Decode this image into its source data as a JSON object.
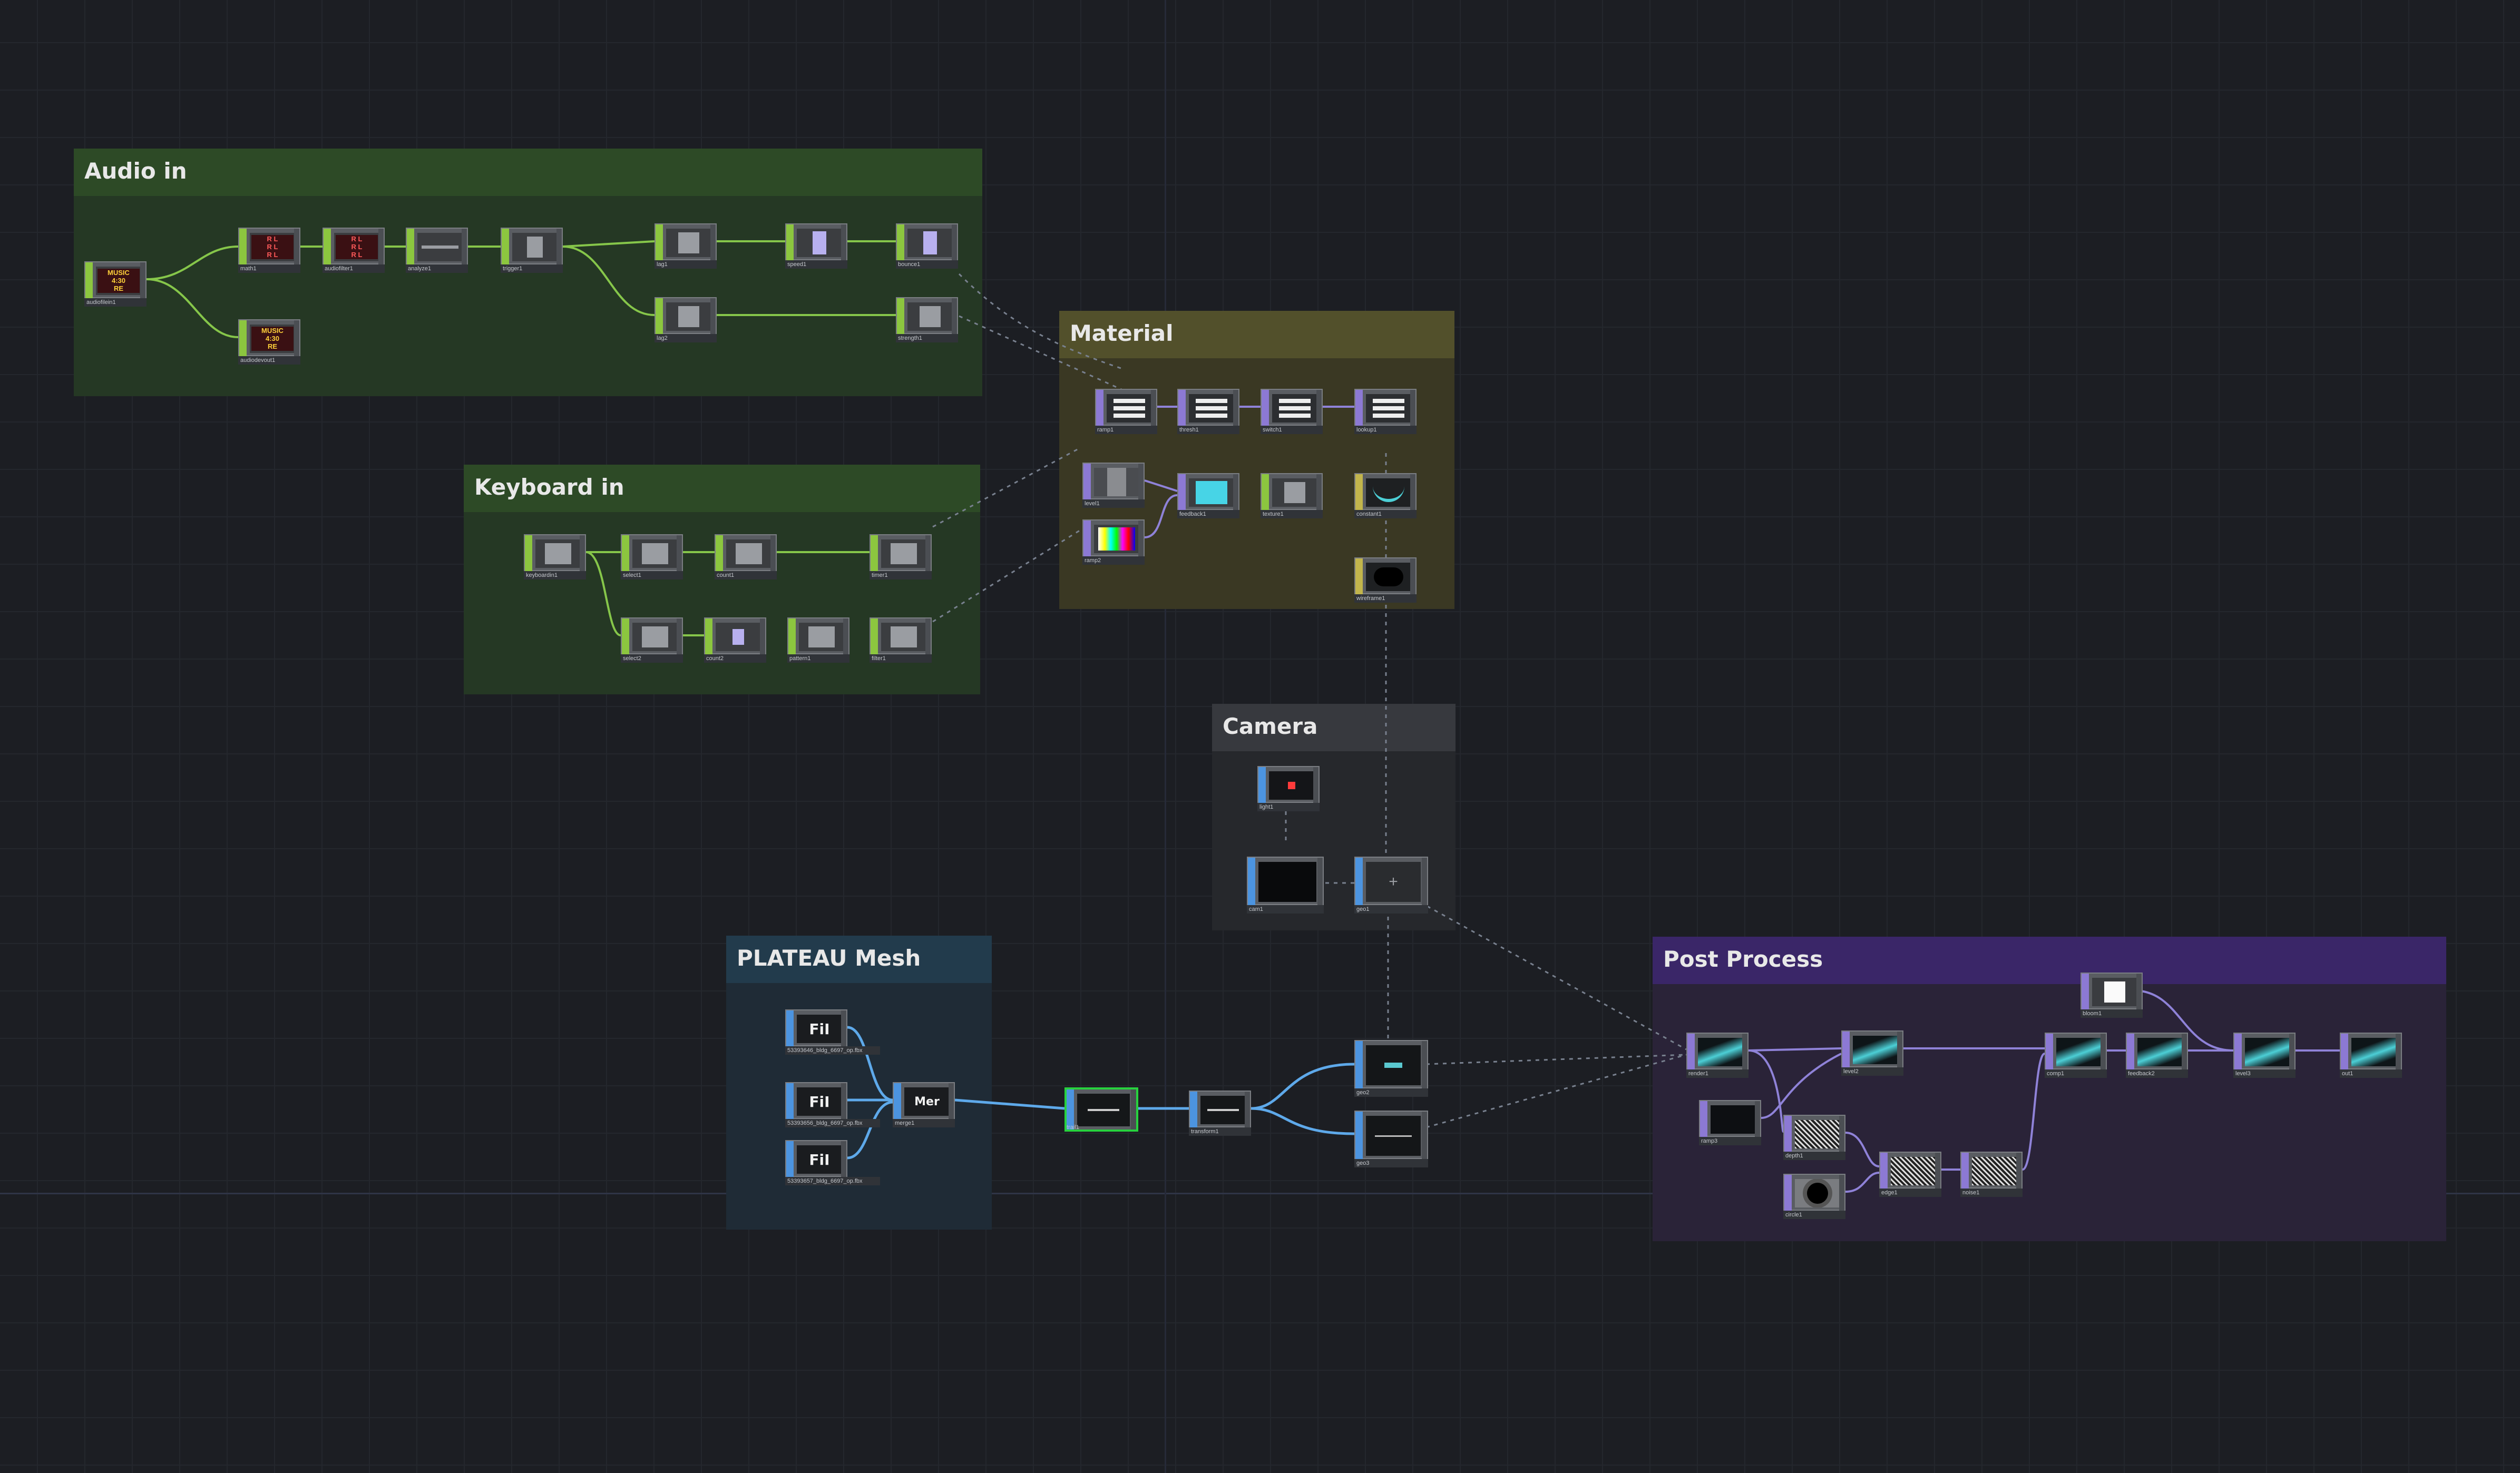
{
  "groups": {
    "audio": {
      "title": "Audio in"
    },
    "keyboard": {
      "title": "Keyboard in"
    },
    "material": {
      "title": "Material"
    },
    "camera": {
      "title": "Camera"
    },
    "plateau": {
      "title": "PLATEAU Mesh"
    },
    "post": {
      "title": "Post Process"
    }
  },
  "nodes": {
    "audiofilein": {
      "name": "audiofilein1"
    },
    "math1": {
      "name": "math1"
    },
    "audiofilter": {
      "name": "audiofilter1"
    },
    "analyze": {
      "name": "analyze1"
    },
    "trigger": {
      "name": "trigger1"
    },
    "lag1": {
      "name": "lag1"
    },
    "speed1": {
      "name": "speed1"
    },
    "bounce": {
      "name": "bounce1"
    },
    "lag2": {
      "name": "lag2"
    },
    "strength": {
      "name": "strength1"
    },
    "audiodevout": {
      "name": "audiodevout1"
    },
    "keyboardin": {
      "name": "keyboardin1"
    },
    "select1": {
      "name": "select1"
    },
    "count1": {
      "name": "count1"
    },
    "timer": {
      "name": "timer1"
    },
    "select2": {
      "name": "select2"
    },
    "count2": {
      "name": "count2"
    },
    "pattern": {
      "name": "pattern1"
    },
    "filter": {
      "name": "filter1"
    },
    "ramp1": {
      "name": "ramp1"
    },
    "thresh": {
      "name": "thresh1"
    },
    "switch1": {
      "name": "switch1"
    },
    "lookup": {
      "name": "lookup1"
    },
    "level1": {
      "name": "level1"
    },
    "ramp2": {
      "name": "ramp2"
    },
    "feedback": {
      "name": "feedback1"
    },
    "texture": {
      "name": "texture1"
    },
    "constant": {
      "name": "constant1"
    },
    "wireframe": {
      "name": "wireframe1"
    },
    "light": {
      "name": "light1"
    },
    "cam": {
      "name": "cam1"
    },
    "geo1": {
      "name": "geo1"
    },
    "file1": {
      "name": "file1",
      "glyph": "FiI",
      "path": "53393646_bldg_6697_op.fbx"
    },
    "file2": {
      "name": "file2",
      "glyph": "FiI",
      "path": "53393656_bldg_6697_op.fbx"
    },
    "file3": {
      "name": "file3",
      "glyph": "FiI",
      "path": "53393657_bldg_6697_op.fbx"
    },
    "merge": {
      "name": "merge1",
      "glyph": "Mer"
    },
    "trail": {
      "name": "trail1"
    },
    "transform": {
      "name": "transform1"
    },
    "geo2": {
      "name": "geo2"
    },
    "geo3": {
      "name": "geo3"
    },
    "render1": {
      "name": "render1"
    },
    "level2": {
      "name": "level2"
    },
    "comp1": {
      "name": "comp1"
    },
    "ramp3": {
      "name": "ramp3"
    },
    "depth": {
      "name": "depth1"
    },
    "edge": {
      "name": "edge1"
    },
    "noise": {
      "name": "noise1"
    },
    "circle": {
      "name": "circle1"
    },
    "feedback2": {
      "name": "feedback2"
    },
    "bloom": {
      "name": "bloom1"
    },
    "level3": {
      "name": "level3"
    },
    "null1": {
      "name": "null1"
    },
    "out1": {
      "name": "out1"
    }
  }
}
